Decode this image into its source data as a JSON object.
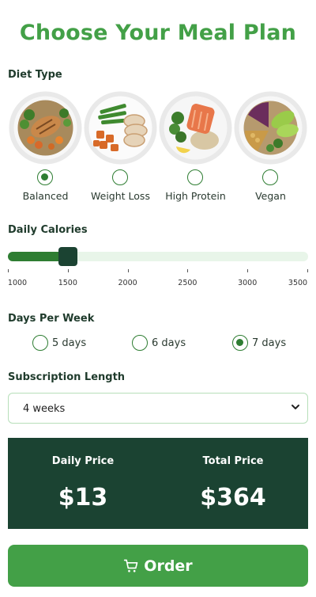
{
  "header": {
    "title": "Choose Your Meal Plan"
  },
  "diet": {
    "label": "Diet Type",
    "options": [
      {
        "label": "Balanced",
        "selected": true,
        "image": "grilled-chicken-quinoa-veg-plate"
      },
      {
        "label": "Weight Loss",
        "selected": false,
        "image": "chicken-sweet-potato-green-beans-plate"
      },
      {
        "label": "High Protein",
        "selected": false,
        "image": "salmon-broccoli-grains-plate"
      },
      {
        "label": "Vegan",
        "selected": false,
        "image": "avocado-chickpea-cabbage-bowl"
      }
    ]
  },
  "calories": {
    "label": "Daily Calories",
    "min": 1000,
    "max": 3500,
    "value": 1500,
    "ticks": [
      "1000",
      "1500",
      "2000",
      "2500",
      "3000",
      "3500"
    ],
    "track_color": "#e8f5e9",
    "fill_color": "#2e7d32",
    "thumb_color": "#1b4332"
  },
  "days": {
    "label": "Days Per Week",
    "options": [
      {
        "label": "5 days",
        "selected": false
      },
      {
        "label": "6 days",
        "selected": false
      },
      {
        "label": "7 days",
        "selected": true
      }
    ]
  },
  "subscription": {
    "label": "Subscription Length",
    "selected": "4 weeks"
  },
  "price": {
    "daily_label": "Daily Price",
    "daily_value": "$13",
    "total_label": "Total Price",
    "total_value": "$364",
    "bg_color": "#1b4332"
  },
  "order": {
    "label": "Order",
    "icon": "cart-icon",
    "color": "#43a047"
  },
  "colors": {
    "accent": "#43a047",
    "dark": "#1b4332"
  }
}
